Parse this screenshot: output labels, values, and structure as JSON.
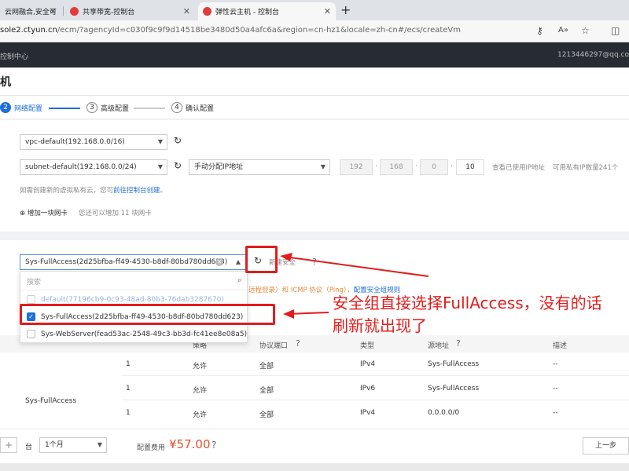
{
  "browser": {
    "tabs": [
      {
        "label": "云网融合,安全可"
      },
      {
        "label": "共享带宽-控制台"
      },
      {
        "label": "弹性云主机 - 控制台"
      }
    ],
    "url_main": "sole2.ctyun.cn",
    "url_rest": "/ecm/?agencyId=c030f9c9f9d14518be3480d50a4afc6a&region=cn-hz1&locale=zh-cn#/ecs/createVm"
  },
  "header": {
    "left": "控制中心",
    "right": "1213446297@qq.co"
  },
  "page": {
    "title_fragment": "机"
  },
  "steps": [
    {
      "num": "2",
      "label": "网络配置"
    },
    {
      "num": "3",
      "label": "高级配置"
    },
    {
      "num": "4",
      "label": "确认配置"
    }
  ],
  "network": {
    "vpc_value": "vpc-default(192.168.0.0/16)",
    "subnet_value": "subnet-default(192.168.0.0/24)",
    "ip_mode": "手动分配IP地址",
    "ip": [
      "192",
      "168",
      "0",
      "10"
    ],
    "view_used_ip": "查看已使用IP地址",
    "available_ip_text": "可用私有IP数量241个",
    "vpc_hint_prefix": "如需创建新的虚拟私有云，您可",
    "vpc_hint_link": "前往控制台创建",
    "vpc_hint_suffix": "。",
    "add_nic": "增加一块网卡",
    "add_nic_hint": "您还可以增加 11 块网卡"
  },
  "security": {
    "selected_value": "Sys-FullAccess(2d25bfba-ff49-4530-b8df-80bd780dd623)",
    "new_sg_link": "新建安全",
    "hint_fragment": "远程登录）和 ICMP 协议（Ping），",
    "hint_link": "配置安全组规则",
    "search_placeholder": "搜索",
    "options": [
      {
        "label": "default(77196cb9-0c93-48ad-80b3-76dab3287670)",
        "checked": false
      },
      {
        "label": "Sys-FullAccess(2d25bfba-ff49-4530-b8df-80bd780dd623)",
        "checked": true
      },
      {
        "label": "Sys-WebServer(fead53ac-2548-49c3-bb3d-fc41ee8e08a5)",
        "checked": false
      }
    ],
    "annotation_line1": "安全组直接选择FullAccess，没有的话",
    "annotation_line2": "刷新就出现了"
  },
  "rules": {
    "headers": {
      "policy": "策略",
      "protocol_port": "协议端口",
      "type": "类型",
      "source": "源地址",
      "desc": "描述"
    },
    "group_name": "Sys-FullAccess",
    "rows": [
      {
        "priority": "1",
        "policy": "允许",
        "port": "全部",
        "type": "IPv4",
        "source": "Sys-FullAccess",
        "desc": "--"
      },
      {
        "priority": "1",
        "policy": "允许",
        "port": "全部",
        "type": "IPv6",
        "source": "Sys-FullAccess",
        "desc": "--"
      },
      {
        "priority": "1",
        "policy": "允许",
        "port": "全部",
        "type": "IPv4",
        "source": "0.0.0.0/0",
        "desc": "--"
      }
    ]
  },
  "footer": {
    "unit": "台",
    "duration": "1个月",
    "price_label": "配置费用",
    "price": "¥57.00",
    "prev_button": "上一步"
  },
  "colors": {
    "accent": "#1e6fd9",
    "annotation": "#e31c1c",
    "price": "#e34f2f"
  }
}
